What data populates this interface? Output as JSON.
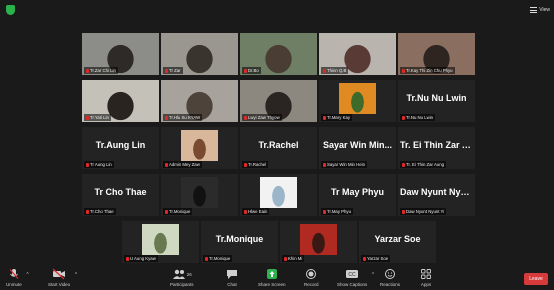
{
  "topbar": {
    "view_label": "View"
  },
  "tiles": [
    {
      "name": "Tr.Zar Chi Lin",
      "big": "",
      "kind": "photo",
      "bg": "#8c8c88",
      "fg": "#2d2a28"
    },
    {
      "name": "Tr Zar",
      "big": "",
      "kind": "photo",
      "bg": "#9a9690",
      "fg": "#3a342f"
    },
    {
      "name": "Dr.Bo",
      "big": "",
      "kind": "photo",
      "bg": "#6e7f66",
      "fg": "#4a3d33"
    },
    {
      "name": "Thinn Q.B",
      "big": "",
      "kind": "photo",
      "bg": "#b9b4ae",
      "fg": "#5a3a35"
    },
    {
      "name": "Tr.Kay Thi Zin Chu Phyu",
      "big": "",
      "kind": "photo",
      "bg": "#8a6f60",
      "fg": "#2e2520"
    },
    {
      "name": "Tr.Yati Lin",
      "big": "",
      "kind": "photo",
      "bg": "#c3c1b8",
      "fg": "#2a2420",
      "active": true
    },
    {
      "name": "Tr.Hlu Su KYAW",
      "big": "",
      "kind": "photo",
      "bg": "#a7a39c",
      "fg": "#4e433b"
    },
    {
      "name": "Lwyi Zaw Thyow",
      "big": "",
      "kind": "photo",
      "bg": "#8c887f",
      "fg": "#2a2522"
    },
    {
      "name": "Tr.Mary Kay",
      "big": "",
      "kind": "inset",
      "bg": "#e08a24",
      "fg": "#3f6b2a"
    },
    {
      "name": "Tr.Nu Nu Lwin",
      "big": "Tr.Nu Nu Lwin",
      "kind": "name"
    },
    {
      "name": "Tr Aung Lin",
      "big": "Tr.Aung Lin",
      "kind": "name"
    },
    {
      "name": "Admin Mey Zaw",
      "big": "",
      "kind": "inset",
      "bg": "#d9b79a",
      "fg": "#7a4a30"
    },
    {
      "name": "Tr.Rachel",
      "big": "Tr.Rachel",
      "kind": "name"
    },
    {
      "name": "Sayar Win Min Hein",
      "big": "Sayar Win Min...",
      "kind": "name"
    },
    {
      "name": "Tr. Ei Thin Zar Aung",
      "big": "Tr. Ei Thin Zar A...",
      "kind": "name"
    },
    {
      "name": "Tr.Cho Thae",
      "big": "Tr Cho Thae",
      "kind": "name"
    },
    {
      "name": "Tr.Monique",
      "big": "",
      "kind": "inset",
      "bg": "#2b2b2b",
      "fg": "#111111"
    },
    {
      "name": "Hlwe Eain",
      "big": "",
      "kind": "inset",
      "bg": "#f2f2f2",
      "fg": "#9bb5c9"
    },
    {
      "name": "Tr.May Phyu",
      "big": "Tr May Phyu",
      "kind": "name"
    },
    {
      "name": "Daw Nyunt Nyunt Yi",
      "big": "Daw Nyunt Nyu...",
      "kind": "name"
    },
    {
      "name": "U Aung Kyaw",
      "big": "",
      "kind": "inset",
      "bg": "#cfd8c0",
      "fg": "#6a7a50"
    },
    {
      "name": "Tr.Monique",
      "big": "Tr.Monique",
      "kind": "name"
    },
    {
      "name": "Khin Mi",
      "big": "",
      "kind": "inset",
      "bg": "#b02a22",
      "fg": "#3a1814"
    },
    {
      "name": "Yarzar Soe",
      "big": "Yarzar Soe",
      "kind": "name"
    }
  ],
  "controls": {
    "unmute": "Unmute",
    "start_video": "Start Video",
    "participants": "Participants",
    "participants_count": "26",
    "chat": "Chat",
    "share_screen": "Share Screen",
    "record": "Record",
    "show_captions": "Show Captions",
    "reactions": "Reactions",
    "apps": "Apps",
    "leave": "Leave"
  },
  "colors": {
    "background": "#1a1a1a",
    "tile": "#232323",
    "active_speaker": "#b6e35a",
    "share_screen_green": "#2bb24c",
    "muted_red": "#e02828",
    "leave_red": "#d63a3a"
  }
}
